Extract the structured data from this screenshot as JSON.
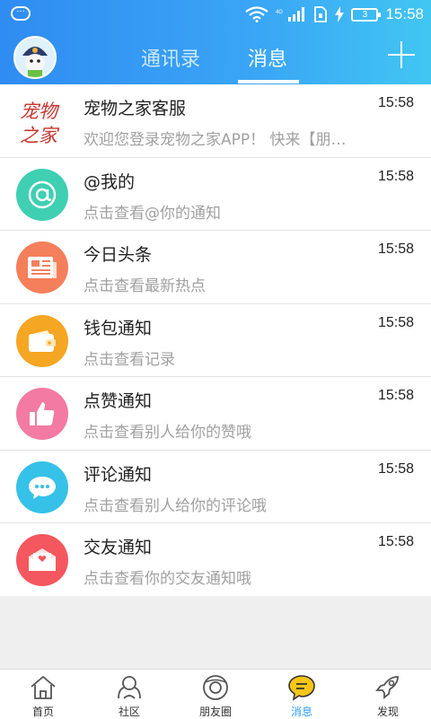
{
  "status_bar": {
    "time": "15:58",
    "battery": "3",
    "network": "4G"
  },
  "header": {
    "tabs": [
      {
        "label": "通讯录"
      },
      {
        "label": "消息"
      }
    ],
    "active_tab": "消息"
  },
  "messages": [
    {
      "title": "宠物之家客服",
      "subtitle": "欢迎您登录宠物之家APP！  快来【朋…",
      "time": "15:58",
      "icon": "pet-home-logo",
      "logo_text": "宠物之家"
    },
    {
      "title": "@我的",
      "subtitle": "点击查看@你的通知",
      "time": "15:58",
      "icon": "at-icon",
      "color": "#3fcfb3"
    },
    {
      "title": "今日头条",
      "subtitle": "点击查看最新热点",
      "time": "15:58",
      "icon": "newspaper-icon",
      "color": "#f57f5b"
    },
    {
      "title": "钱包通知",
      "subtitle": "点击查看记录",
      "time": "15:58",
      "icon": "wallet-icon",
      "color": "#f5a623"
    },
    {
      "title": "点赞通知",
      "subtitle": "点击查看别人给你的赞哦",
      "time": "15:58",
      "icon": "thumbs-up-icon",
      "color": "#f27aa3"
    },
    {
      "title": "评论通知",
      "subtitle": "点击查看别人给你的评论哦",
      "time": "15:58",
      "icon": "comment-icon",
      "color": "#35c1e8"
    },
    {
      "title": "交友通知",
      "subtitle": "点击查看你的交友通知哦",
      "time": "15:58",
      "icon": "envelope-heart-icon",
      "color": "#f5575e"
    }
  ],
  "bottom_nav": [
    {
      "label": "首页",
      "icon": "home-icon"
    },
    {
      "label": "社区",
      "icon": "community-icon"
    },
    {
      "label": "朋友圈",
      "icon": "moments-icon"
    },
    {
      "label": "消息",
      "icon": "message-icon",
      "active": true
    },
    {
      "label": "发现",
      "icon": "rocket-icon"
    }
  ],
  "colors": {
    "header_start": "#2f8cf2",
    "header_end": "#41c6f2",
    "active_nav": "#2f9df2",
    "nav_message_accent": "#f5c518"
  }
}
